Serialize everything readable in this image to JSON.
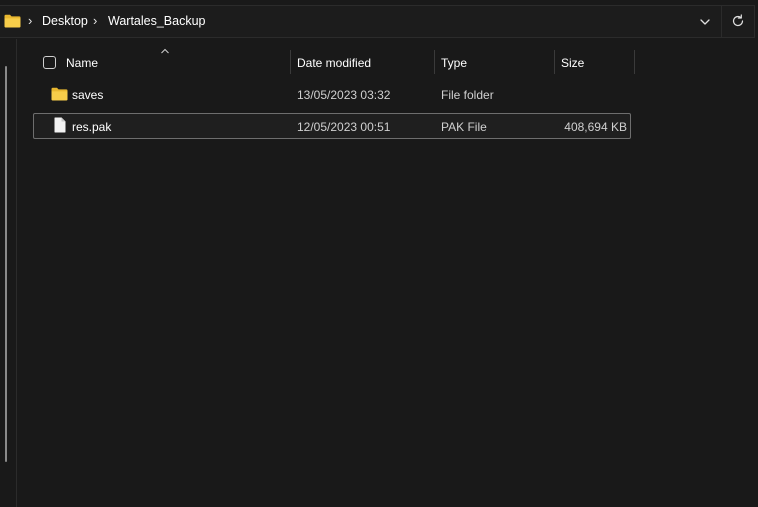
{
  "address_bar": {
    "breadcrumbs": [
      "Desktop",
      "Wartales_Backup"
    ],
    "icons": {
      "location": "folder-icon",
      "dropdown": "chevron-down-icon",
      "refresh": "refresh-icon"
    }
  },
  "columns": {
    "name": "Name",
    "date_modified": "Date modified",
    "type": "Type",
    "size": "Size",
    "sorted_by": "Name"
  },
  "files": [
    {
      "name": "saves",
      "date_modified": "13/05/2023 03:32",
      "type": "File folder",
      "size": "",
      "icon": "folder-icon",
      "selected": false
    },
    {
      "name": "res.pak",
      "date_modified": "12/05/2023 00:51",
      "type": "PAK File",
      "size": "408,694 KB",
      "icon": "file-icon",
      "selected": true
    }
  ],
  "colors": {
    "background": "#191919",
    "folder": "#f4c542",
    "selection_border": "#6e6e6e"
  }
}
